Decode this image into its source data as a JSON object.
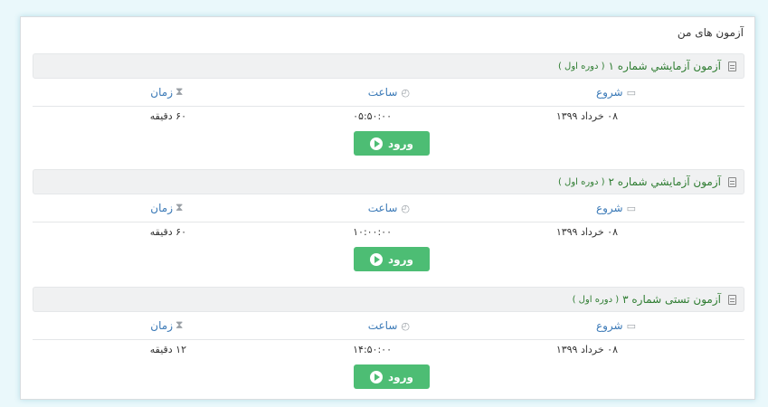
{
  "page": {
    "title": "آزمون های من"
  },
  "columns": {
    "start": "شروع",
    "time": "ساعت",
    "duration": "زمان"
  },
  "icons": {
    "header": "document-icon",
    "start": "calendar-icon",
    "time": "clock-icon",
    "duration": "hourglass-icon",
    "enter": "play-circle-icon"
  },
  "colors": {
    "title_green": "#2f7d32",
    "column_blue": "#3a79b7",
    "button_green": "#4dbd74"
  },
  "exams": [
    {
      "title": "آزمون آزمايشي شماره ۱",
      "term": "( دوره اول )",
      "start": "۰۸ خرداد ۱۳۹۹",
      "time": "۰۵:۵۰:۰۰",
      "duration": "۶۰ دقيقه",
      "button": "ورود"
    },
    {
      "title": "آزمون آزمايشي شماره ۲",
      "term": "( دوره اول )",
      "start": "۰۸ خرداد ۱۳۹۹",
      "time": "۱۰:۰۰:۰۰",
      "duration": "۶۰ دقيقه",
      "button": "ورود"
    },
    {
      "title": "آزمون تستی شماره ۳",
      "term": "( دوره اول )",
      "start": "۰۸ خرداد ۱۳۹۹",
      "time": "۱۴:۵۰:۰۰",
      "duration": "۱۲ دقيقه",
      "button": "ورود"
    }
  ]
}
